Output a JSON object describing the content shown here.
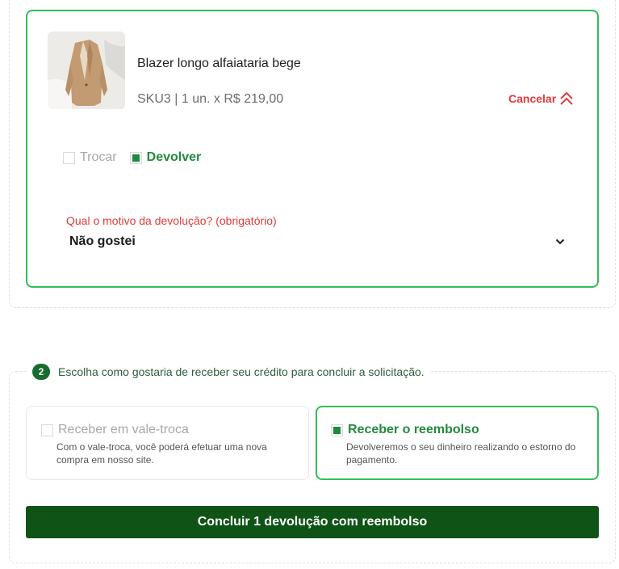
{
  "item": {
    "name": "Blazer longo alfaiataria bege",
    "meta": "SKU3 | 1 un. x R$ 219,00",
    "cancel_label": "Cancelar",
    "options": {
      "trocar_label": "Trocar",
      "devolver_label": "Devolver",
      "selected": "devolver"
    },
    "reason": {
      "label": "Qual o motivo da devolução? (obrigatório)",
      "value": "Não gostei"
    }
  },
  "step2": {
    "number": "2",
    "instruction": "Escolha como gostaria de receber seu crédito para concluir a solicitação.",
    "options": [
      {
        "title": "Receber em vale-troca",
        "description": "Com o vale-troca, você poderá efetuar uma nova compra em nosso site.",
        "selected": false
      },
      {
        "title": "Receber o reembolso",
        "description": "Devolveremos o seu dinheiro realizando o estorno do pagamento.",
        "selected": true
      }
    ]
  },
  "submit_label": "Concluir 1 devolução com reembolso",
  "colors": {
    "accent_green": "#2fbf55",
    "dark_green": "#0f5416",
    "danger_red": "#e03a3a"
  }
}
